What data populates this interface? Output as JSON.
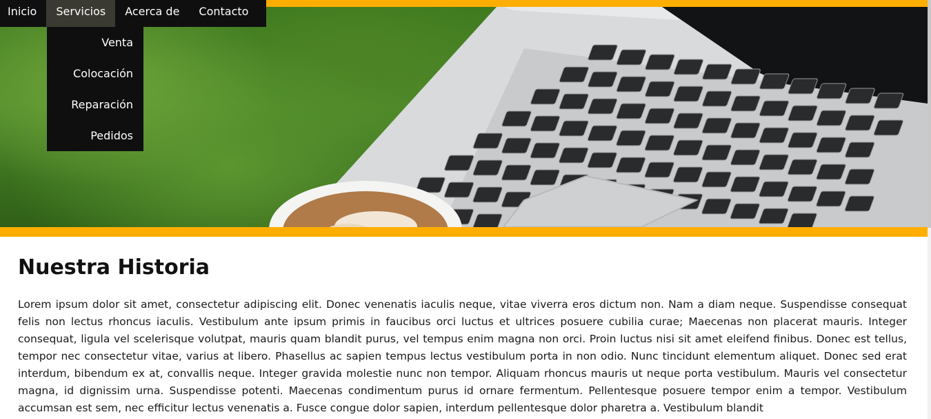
{
  "nav": {
    "items": [
      {
        "label": "Inicio"
      },
      {
        "label": "Servicios"
      },
      {
        "label": "Acerca de"
      },
      {
        "label": "Contacto"
      }
    ],
    "active_index": 1,
    "submenu": [
      {
        "label": "Venta"
      },
      {
        "label": "Colocación"
      },
      {
        "label": "Reparación"
      },
      {
        "label": "Pedidos"
      }
    ]
  },
  "colors": {
    "accent": "#ffae00",
    "nav_bg": "#0f0f10",
    "nav_active_bg": "#3a3a32",
    "text": "#111111"
  },
  "content": {
    "title": "Nuestra Historia",
    "paragraph": "Lorem ipsum dolor sit amet, consectetur adipiscing elit. Donec venenatis iaculis neque, vitae viverra eros dictum non. Nam a diam neque. Suspendisse consequat felis non lectus rhoncus iaculis. Vestibulum ante ipsum primis in faucibus orci luctus et ultrices posuere cubilia curae; Maecenas non placerat mauris. Integer consequat, ligula vel scelerisque volutpat, mauris quam blandit purus, vel tempus enim magna non orci. Proin luctus nisi sit amet eleifend finibus. Donec est tellus, tempor nec consectetur vitae, varius at libero. Phasellus ac sapien tempus lectus vestibulum porta in non odio. Nunc tincidunt elementum aliquet. Donec sed erat interdum, bibendum ex at, convallis neque. Integer gravida molestie nunc non tempor. Aliquam rhoncus mauris ut neque porta vestibulum. Mauris vel consectetur magna, id dignissim urna. Suspendisse potenti. Maecenas condimentum purus id ornare fermentum. Pellentesque posuere tempor enim a tempor. Vestibulum accumsan est sem, nec efficitur lectus venenatis a. Fusce congue dolor sapien, interdum pellentesque dolor pharetra a. Vestibulum blandit"
  }
}
